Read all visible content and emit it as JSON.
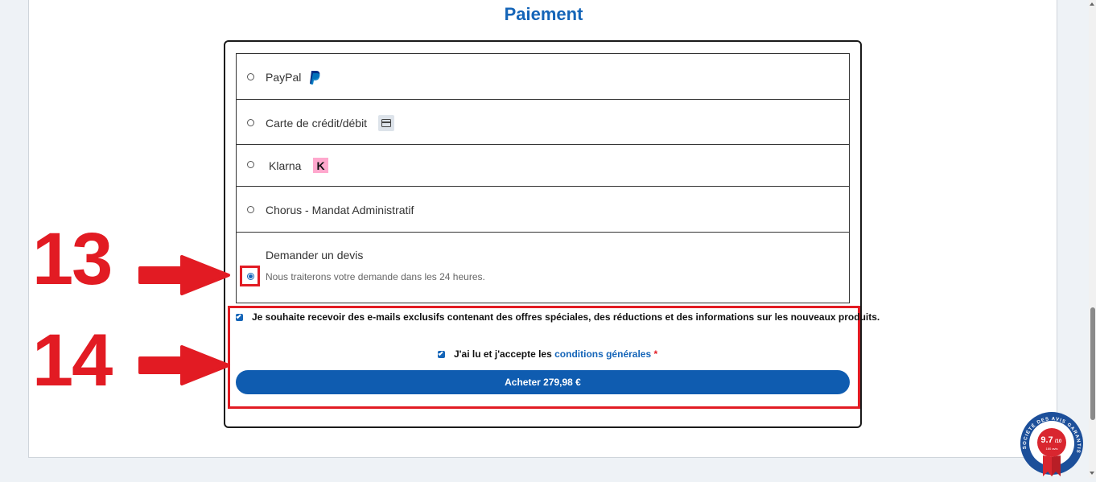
{
  "section_title": "Paiement",
  "payment_methods": [
    {
      "label": "PayPal",
      "icon": "paypal-icon",
      "selected": false
    },
    {
      "label": "Carte de crédit/débit",
      "icon": "credit-card-icon",
      "selected": false
    },
    {
      "label": "Klarna",
      "icon": "klarna-icon",
      "selected": false
    },
    {
      "label": "Chorus - Mandat Administratif",
      "icon": "",
      "selected": false
    },
    {
      "label": "Demander un devis",
      "description": "Nous traiterons votre demande dans les 24 heures.",
      "selected": true
    }
  ],
  "newsletter": {
    "label": "Je souhaite recevoir des e-mails exclusifs contenant des offres spéciales, des réductions et des informations sur les nouveaux produits.",
    "checked": true
  },
  "terms": {
    "prefix": "J'ai lu et j'accepte les ",
    "link": "conditions générales",
    "required_mark": "*",
    "checked": true
  },
  "buy_button": "Acheter 279,98 €",
  "annotations": {
    "step13": "13",
    "step14": "14"
  },
  "badge": {
    "score": "9.7",
    "scale": "/10",
    "reviews": "180 avis",
    "ring_text": "SOCIÉTÉ DES AVIS GARANTIS"
  },
  "colors": {
    "accent": "#1565b8",
    "annotation_red": "#e21b23",
    "button": "#0f5cb0",
    "klarna_pink": "#ffa8cd"
  }
}
